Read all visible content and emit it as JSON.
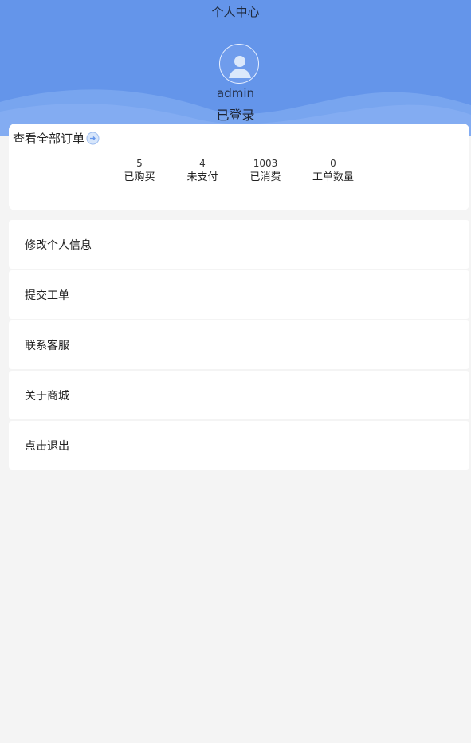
{
  "header": {
    "title": "个人中心",
    "username": "admin",
    "login_status": "已登录",
    "background_color": "#6495ea",
    "avatar_icon": "user-avatar-icon"
  },
  "orders": {
    "view_all_label": "查看全部订单",
    "link_icon": "arrow-circle-icon",
    "stats": [
      {
        "value": "5",
        "label": "已购买"
      },
      {
        "value": "4",
        "label": "未支付"
      },
      {
        "value": "1003",
        "label": "已消费"
      },
      {
        "value": "0",
        "label": "工单数量"
      }
    ]
  },
  "menu": [
    {
      "label": "修改个人信息"
    },
    {
      "label": "提交工单"
    },
    {
      "label": "联系客服"
    },
    {
      "label": "关于商城"
    },
    {
      "label": "点击退出"
    }
  ]
}
